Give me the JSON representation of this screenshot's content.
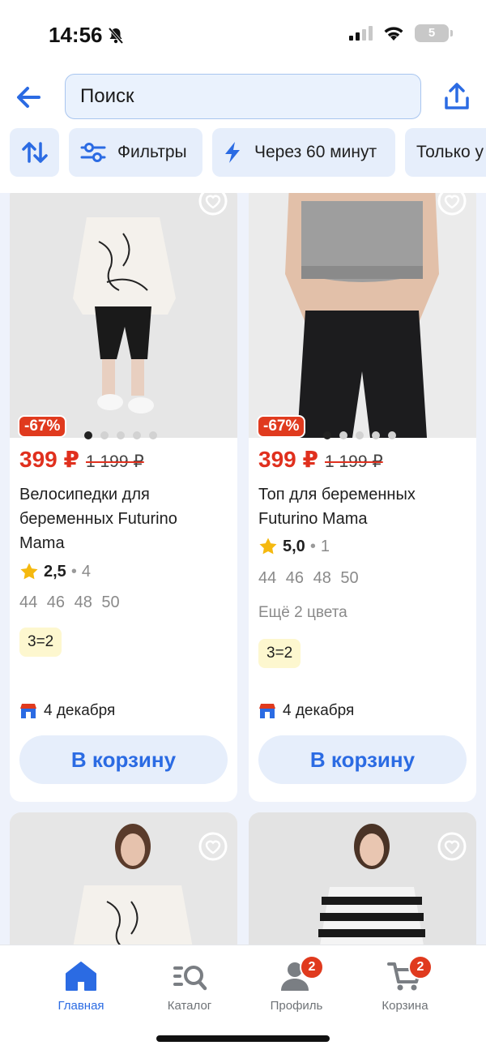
{
  "status": {
    "time": "14:56",
    "battery": "5"
  },
  "search": {
    "placeholder": "Поиск"
  },
  "chips": [
    {
      "label": "",
      "icon": "sort-icon"
    },
    {
      "label": "Фильтры",
      "icon": "filters-icon"
    },
    {
      "label": "Через 60 минут",
      "icon": "lightning-icon"
    },
    {
      "label": "Только у",
      "icon": ""
    }
  ],
  "products": [
    {
      "discount": "-67%",
      "price": "399 ₽",
      "old_price": "1 199 ₽",
      "title": "Велосипедки для беременных Futurino Mama",
      "rating": "2,5",
      "reviews": "4",
      "sizes": "44 46 48 50",
      "colors": "",
      "promo": "3=2",
      "delivery": "4 декабря",
      "cart_label": "В корзину"
    },
    {
      "discount": "-67%",
      "price": "399 ₽",
      "old_price": "1 199 ₽",
      "title": "Топ для беременных Futurino Mama",
      "rating": "5,0",
      "reviews": "1",
      "sizes": "44 46 48 50",
      "colors": "Ещё 2 цвета",
      "promo": "3=2",
      "delivery": "4 декабря",
      "cart_label": "В корзину"
    }
  ],
  "nav": {
    "items": [
      {
        "label": "Главная",
        "icon": "home-icon",
        "active": true,
        "badge": ""
      },
      {
        "label": "Каталог",
        "icon": "catalog-icon",
        "active": false,
        "badge": ""
      },
      {
        "label": "Профиль",
        "icon": "profile-icon",
        "active": false,
        "badge": "2"
      },
      {
        "label": "Корзина",
        "icon": "cart-icon",
        "active": false,
        "badge": "2"
      }
    ]
  },
  "colors": {
    "accent": "#2b6be3",
    "sale": "#e0301e",
    "chip_bg": "#e6eefb",
    "page_bg": "#eef2fb"
  }
}
